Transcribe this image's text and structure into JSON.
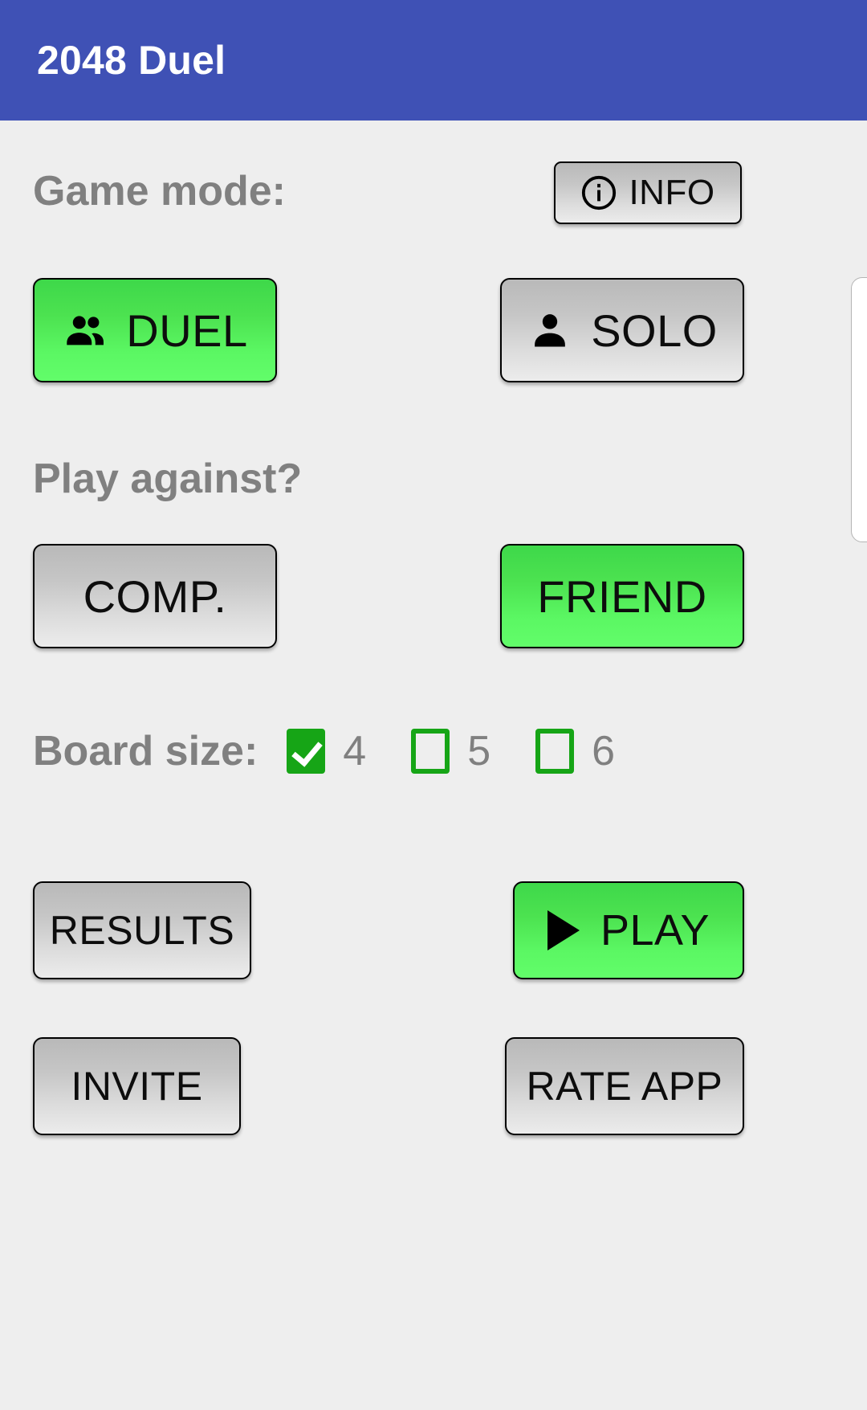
{
  "appbar": {
    "title": "2048 Duel"
  },
  "sections": {
    "game_mode_label": "Game mode:",
    "play_against_label": "Play against?",
    "board_size_label": "Board size:"
  },
  "info_button": {
    "label": "INFO",
    "icon": "info-circle-icon"
  },
  "game_mode": {
    "options": [
      {
        "label": "DUEL",
        "icon": "people-icon",
        "selected": true
      },
      {
        "label": "SOLO",
        "icon": "person-icon",
        "selected": false
      }
    ]
  },
  "play_against": {
    "options": [
      {
        "label": "COMP.",
        "selected": false
      },
      {
        "label": "FRIEND",
        "selected": true
      }
    ]
  },
  "board_size": {
    "options": [
      {
        "label": "4",
        "checked": true
      },
      {
        "label": "5",
        "checked": false
      },
      {
        "label": "6",
        "checked": false
      }
    ]
  },
  "actions": {
    "results_label": "RESULTS",
    "play_label": "PLAY",
    "play_icon": "play-triangle-icon",
    "invite_label": "INVITE",
    "rate_app_label": "RATE APP"
  },
  "colors": {
    "appbar": "#3f51b5",
    "background": "#eeeeee",
    "selected_green": "#5bf763",
    "unselected_grey": "#c6c6c6",
    "checkbox_green": "#16a516",
    "label_grey": "#808080",
    "title_white": "#ffffff"
  }
}
